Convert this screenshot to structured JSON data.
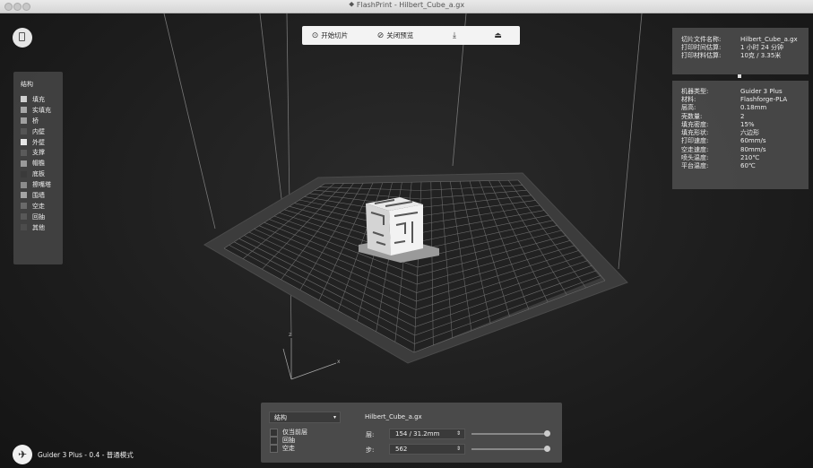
{
  "window": {
    "title": "FlashPrint - Hilbert_Cube_a.gx"
  },
  "toolbar": {
    "start_slice": "开始切片",
    "close_preview": "关闭预览"
  },
  "left_panel": {
    "title": "结构",
    "items": [
      {
        "label": "填充",
        "color": "#d0d0d0"
      },
      {
        "label": "实填充",
        "color": "#a8a8a8"
      },
      {
        "label": "桥",
        "color": "#a0a0a0"
      },
      {
        "label": "内壁",
        "color": "#555555"
      },
      {
        "label": "外壁",
        "color": "#e6e6e6"
      },
      {
        "label": "支撑",
        "color": "#5a5a5a"
      },
      {
        "label": "帽檐",
        "color": "#9a9a9a"
      },
      {
        "label": "底板",
        "color": "#3a3a3a"
      },
      {
        "label": "擦嘴塔",
        "color": "#8c8c8c"
      },
      {
        "label": "围墙",
        "color": "#a5a5a5"
      },
      {
        "label": "空走",
        "color": "#6a6a6a"
      },
      {
        "label": "回抽",
        "color": "#585858"
      },
      {
        "label": "其他",
        "color": "#4c4c4c"
      }
    ]
  },
  "slice_info": [
    {
      "key": "切片文件名称:",
      "value": "Hilbert_Cube_a.gx"
    },
    {
      "key": "打印时间估算:",
      "value": "1 小时 24 分钟"
    },
    {
      "key": "打印材料估算:",
      "value": "10克 / 3.35米"
    }
  ],
  "machine_info": [
    {
      "key": "机器类型:",
      "value": "Guider 3 Plus"
    },
    {
      "key": "材料:",
      "value": "Flashforge-PLA"
    },
    {
      "key": "层高:",
      "value": "0.18mm"
    },
    {
      "key": "壳数量:",
      "value": "2"
    },
    {
      "key": "填充密度:",
      "value": "15%"
    },
    {
      "key": "填充形状:",
      "value": "六边形"
    },
    {
      "key": "打印速度:",
      "value": "60mm/s"
    },
    {
      "key": "空走速度:",
      "value": "80mm/s"
    },
    {
      "key": "喷头温度:",
      "value": "210℃"
    },
    {
      "key": "平台温度:",
      "value": "60℃"
    }
  ],
  "bottom_panel": {
    "view_select": "结构",
    "options": [
      "仅当前层",
      "回抽",
      "空走"
    ],
    "file_name": "Hilbert_Cube_a.gx",
    "layer_label": "层:",
    "layer_value": "154 / 31.2mm",
    "step_label": "步:",
    "step_value": "562",
    "layer_slider_level": 1.0,
    "step_slider_level": 1.0
  },
  "status": {
    "text": "Guider 3 Plus - 0.4 - 普通模式"
  },
  "axis": {
    "z": "z",
    "x": "x"
  }
}
